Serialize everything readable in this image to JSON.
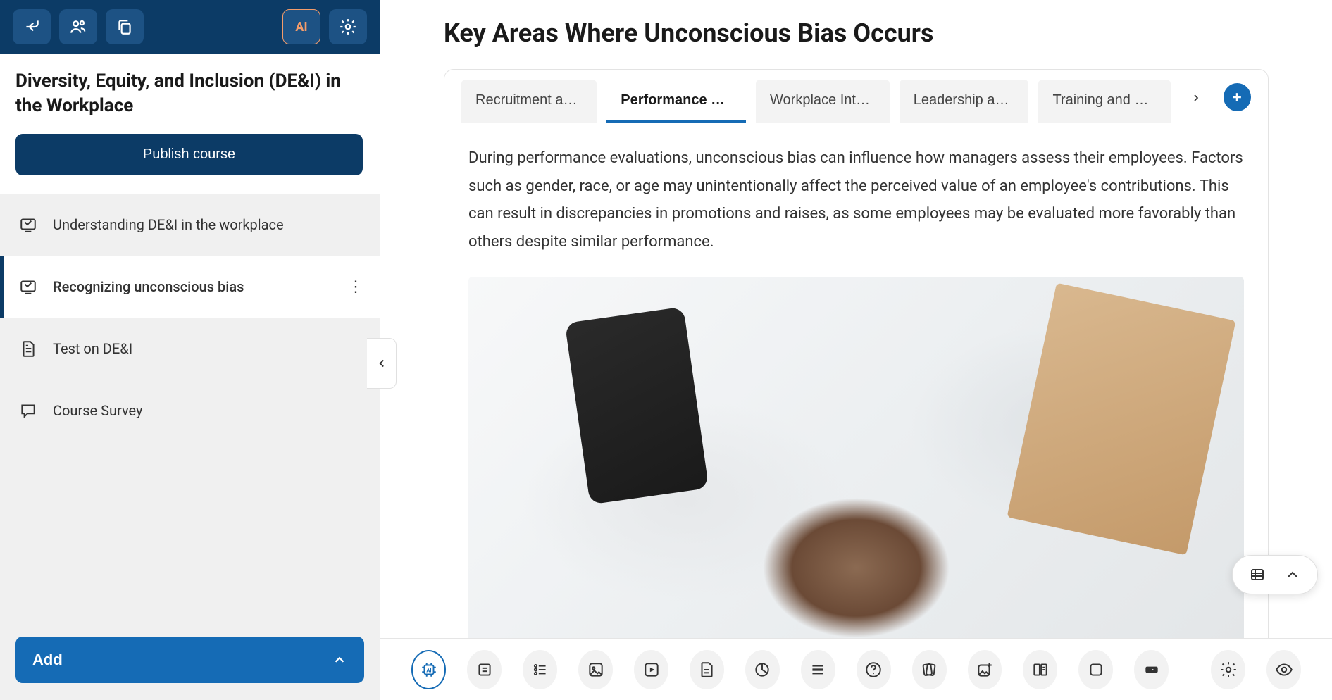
{
  "sidebar": {
    "top": {
      "ai_label": "AI"
    },
    "course_title": "Diversity, Equity, and Inclusion (DE&I) in the Workplace",
    "publish_label": "Publish course",
    "items": [
      {
        "label": "Understanding DE&I in the workplace",
        "icon": "slides"
      },
      {
        "label": "Recognizing unconscious bias",
        "icon": "slides",
        "active": true
      },
      {
        "label": "Test on DE&I",
        "icon": "doc"
      },
      {
        "label": "Course Survey",
        "icon": "chat"
      }
    ],
    "add_label": "Add"
  },
  "main": {
    "section_title": "Key Areas Where Unconscious Bias Occurs",
    "tabs": [
      {
        "label": "Recruitment an…"
      },
      {
        "label": "Performance E…",
        "active": true
      },
      {
        "label": "Workplace Inte…"
      },
      {
        "label": "Leadership an…"
      },
      {
        "label": "Training and D…"
      }
    ],
    "body_text": "During performance evaluations, unconscious bias can influence how managers assess their employees. Factors such as gender, race, or age may unintentionally affect the perceived value of an employee's contributions. This can result in discrepancies in promotions and raises, as some employees may be evaluated more favorably than others despite similar performance."
  },
  "toolbar": {
    "tools": [
      {
        "name": "ai",
        "label": "AI"
      },
      {
        "name": "text"
      },
      {
        "name": "list"
      },
      {
        "name": "image"
      },
      {
        "name": "video"
      },
      {
        "name": "document"
      },
      {
        "name": "chart"
      },
      {
        "name": "divider"
      },
      {
        "name": "help"
      },
      {
        "name": "cards"
      },
      {
        "name": "image-plus"
      },
      {
        "name": "columns"
      },
      {
        "name": "container"
      },
      {
        "name": "button"
      }
    ],
    "right": [
      {
        "name": "settings"
      },
      {
        "name": "preview"
      }
    ]
  }
}
